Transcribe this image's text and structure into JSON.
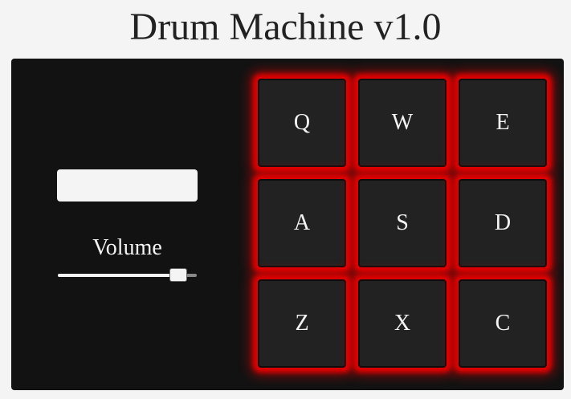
{
  "app": {
    "title": "Drum Machine v1.0"
  },
  "display": {
    "text": ""
  },
  "volume": {
    "label": "Volume",
    "value": 0.92
  },
  "pads": [
    {
      "key": "Q"
    },
    {
      "key": "W"
    },
    {
      "key": "E"
    },
    {
      "key": "A"
    },
    {
      "key": "S"
    },
    {
      "key": "D"
    },
    {
      "key": "Z"
    },
    {
      "key": "X"
    },
    {
      "key": "C"
    }
  ],
  "colors": {
    "background": "#f4f4f4",
    "machine": "#121212",
    "pad": "#222222",
    "glow": "#e00000"
  }
}
